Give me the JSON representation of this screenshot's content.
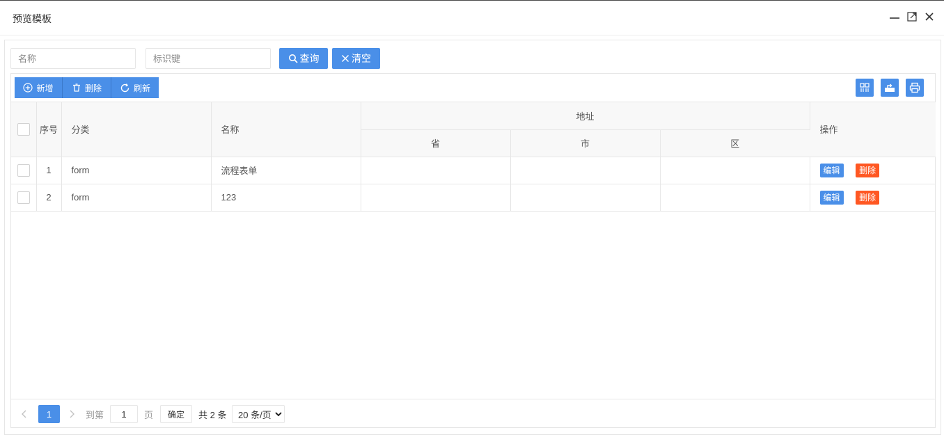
{
  "window": {
    "title": "预览模板",
    "controls": [
      "minimize-icon",
      "maximize-icon",
      "close-icon"
    ]
  },
  "search": {
    "name_placeholder": "名称",
    "key_placeholder": "标识键",
    "query_label": "查询",
    "clear_label": "清空"
  },
  "toolbar": {
    "add_label": "新增",
    "delete_label": "删除",
    "refresh_label": "刷新",
    "right_icons": [
      "columns-icon",
      "export-icon",
      "print-icon"
    ]
  },
  "table": {
    "headers": {
      "index": "序号",
      "category": "分类",
      "name": "名称",
      "address": "地址",
      "province": "省",
      "city": "市",
      "district": "区",
      "actions": "操作"
    },
    "rows": [
      {
        "index": "1",
        "category": "form",
        "name": "流程表单",
        "province": "",
        "city": "",
        "district": ""
      },
      {
        "index": "2",
        "category": "form",
        "name": "123",
        "province": "",
        "city": "",
        "district": ""
      }
    ],
    "edit_label": "编辑",
    "delete_label": "删除"
  },
  "pagination": {
    "current_page": "1",
    "goto_label": "到第",
    "goto_value": "1",
    "page_label": "页",
    "confirm_label": "确定",
    "total_text": "共 2 条",
    "page_size": "20 条/页"
  },
  "colors": {
    "primary": "#4a8fe8",
    "danger": "#ff5722",
    "border": "#e6e6e6",
    "header_bg": "#f8f8f8"
  }
}
